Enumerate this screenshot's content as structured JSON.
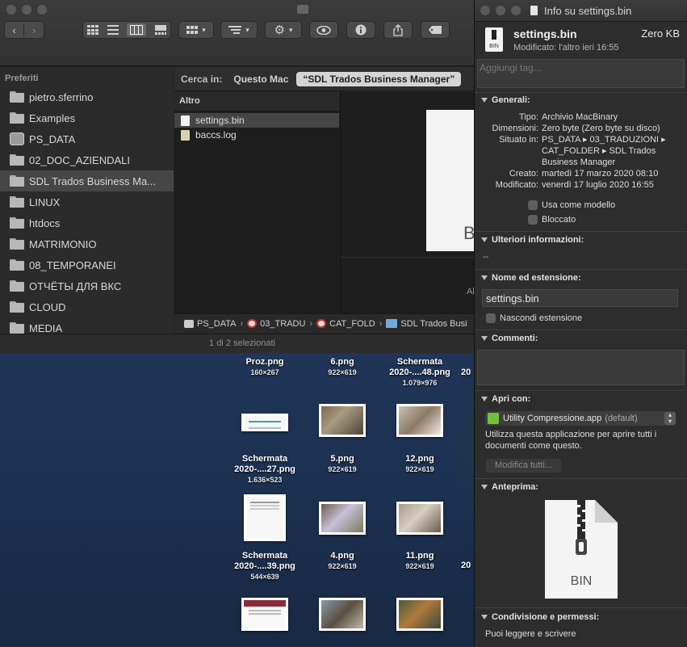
{
  "finder": {
    "sidebar": {
      "heading": "Preferiti",
      "items": [
        {
          "label": "pietro.sferrino",
          "icon": "folder-icon"
        },
        {
          "label": "Examples",
          "icon": "folder-icon"
        },
        {
          "label": "PS_DATA",
          "icon": "disk-icon"
        },
        {
          "label": "02_DOC_AZIENDALI",
          "icon": "folder-icon"
        },
        {
          "label": "SDL Trados Business Ma...",
          "icon": "folder-icon"
        },
        {
          "label": "LINUX",
          "icon": "folder-icon"
        },
        {
          "label": "htdocs",
          "icon": "folder-icon"
        },
        {
          "label": "MATRIMONIO",
          "icon": "folder-icon"
        },
        {
          "label": "08_TEMPORANEI",
          "icon": "folder-icon"
        },
        {
          "label": "ОТЧЁТЫ ДЛЯ ВКС",
          "icon": "folder-icon"
        },
        {
          "label": "CLOUD",
          "icon": "folder-icon"
        },
        {
          "label": "MEDIA",
          "icon": "folder-icon"
        }
      ],
      "selected_index": 4
    },
    "search": {
      "label": "Cerca in:",
      "scope_mac": "Questo Mac",
      "scope_folder": "“SDL Trados Business Manager”"
    },
    "column_header": "Altro",
    "files": [
      {
        "name": "settings.bin",
        "selected": true
      },
      {
        "name": "baccs.log",
        "selected": false
      }
    ],
    "preview": {
      "letter": "B",
      "caption": "Al"
    },
    "pathbar": [
      "PS_DATA",
      "03_TRADU",
      "CAT_FOLD",
      "SDL Trados Busi"
    ],
    "status": "1 di 2 selezionati"
  },
  "desktop": {
    "items": [
      {
        "name": "Proz.png",
        "sub": "160×267"
      },
      {
        "name": "6.png",
        "sub": "922×619"
      },
      {
        "name": "Schermata 2020-....48.png",
        "sub": "1.079×976"
      },
      {
        "name": "Schermata 2020-....27.png",
        "sub": "1.636×523"
      },
      {
        "name": "5.png",
        "sub": "922×619"
      },
      {
        "name": "12.png",
        "sub": "922×619"
      },
      {
        "name": "Schermata 2020-....39.png",
        "sub": "544×639"
      },
      {
        "name": "4.png",
        "sub": "922×619"
      },
      {
        "name": "11.png",
        "sub": "922×619"
      }
    ],
    "edge_labels": [
      "20",
      "20"
    ]
  },
  "info": {
    "window_title": "Info su settings.bin",
    "file_name": "settings.bin",
    "file_size": "Zero KB",
    "modified_short": "Modificato: l'altro ieri 16:55",
    "icon_label": "BIN",
    "tags_placeholder": "Aggiungi tag...",
    "general": {
      "title": "Generali:",
      "rows": [
        {
          "k": "Tipo:",
          "v": "Archivio MacBinary"
        },
        {
          "k": "Dimensioni:",
          "v": "Zero byte (Zero byte su disco)"
        },
        {
          "k": "Situato in:",
          "v": "PS_DATA ▸ 03_TRADUZIONI ▸ CAT_FOLDER ▸ SDL Trados Business Manager"
        },
        {
          "k": "Creato:",
          "v": "martedì 17 marzo 2020 08:10"
        },
        {
          "k": "Modificato:",
          "v": "venerdì 17 luglio 2020 16:55"
        }
      ],
      "template_label": "Usa come modello",
      "locked_label": "Bloccato"
    },
    "more_info": {
      "title": "Ulteriori informazioni:",
      "value": "--"
    },
    "name_ext": {
      "title": "Nome ed estensione:",
      "value": "settings.bin",
      "hide_ext_label": "Nascondi estensione"
    },
    "comments": {
      "title": "Commenti:"
    },
    "open_with": {
      "title": "Apri con:",
      "app": "Utility Compressione.app",
      "app_default": "(default)",
      "description": "Utilizza questa applicazione per aprire tutti i documenti come questo.",
      "change_all": "Modifica tutti..."
    },
    "preview": {
      "title": "Anteprima:",
      "label": "BIN"
    },
    "sharing": {
      "title": "Condivisione e permessi:",
      "value": "Puoi leggere e scrivere"
    }
  },
  "colors": {
    "accent_green": "#6fc13a",
    "selection": "#464646"
  }
}
